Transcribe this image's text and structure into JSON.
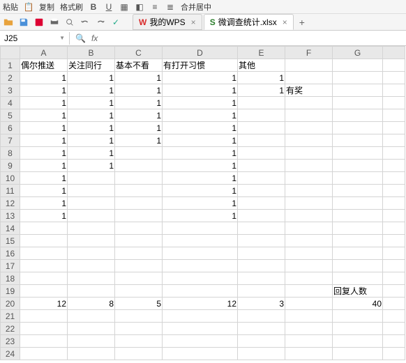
{
  "toolbar_top": {
    "paste_label": "粘贴",
    "copy_label": "复制",
    "format_painter_label": "格式刷",
    "merge_label": "合并居中"
  },
  "toolbar2": {},
  "tabs": {
    "t1_label": "我的WPS",
    "t2_label": "微调查统计.xlsx"
  },
  "namebox": {
    "value": "J25"
  },
  "columns": [
    "A",
    "B",
    "C",
    "D",
    "E",
    "F",
    "G",
    ""
  ],
  "headers": {
    "A": "偶尔推送",
    "B": "关注同行",
    "C": "基本不看",
    "D": "有打开习惯",
    "E": "其他",
    "G19": "回复人数",
    "F3": "有奖"
  },
  "cells": {
    "r2": {
      "A": "1",
      "B": "1",
      "C": "1",
      "D": "1",
      "E": "1"
    },
    "r3": {
      "A": "1",
      "B": "1",
      "C": "1",
      "D": "1",
      "E": "1"
    },
    "r4": {
      "A": "1",
      "B": "1",
      "C": "1",
      "D": "1"
    },
    "r5": {
      "A": "1",
      "B": "1",
      "C": "1",
      "D": "1"
    },
    "r6": {
      "A": "1",
      "B": "1",
      "C": "1",
      "D": "1"
    },
    "r7": {
      "A": "1",
      "B": "1",
      "C": "1",
      "D": "1"
    },
    "r8": {
      "A": "1",
      "B": "1",
      "D": "1"
    },
    "r9": {
      "A": "1",
      "B": "1",
      "D": "1"
    },
    "r10": {
      "A": "1",
      "D": "1"
    },
    "r11": {
      "A": "1",
      "D": "1"
    },
    "r12": {
      "A": "1",
      "D": "1"
    },
    "r13": {
      "A": "1",
      "D": "1"
    },
    "r20": {
      "A": "12",
      "B": "8",
      "C": "5",
      "D": "12",
      "E": "3",
      "G": "40"
    }
  }
}
